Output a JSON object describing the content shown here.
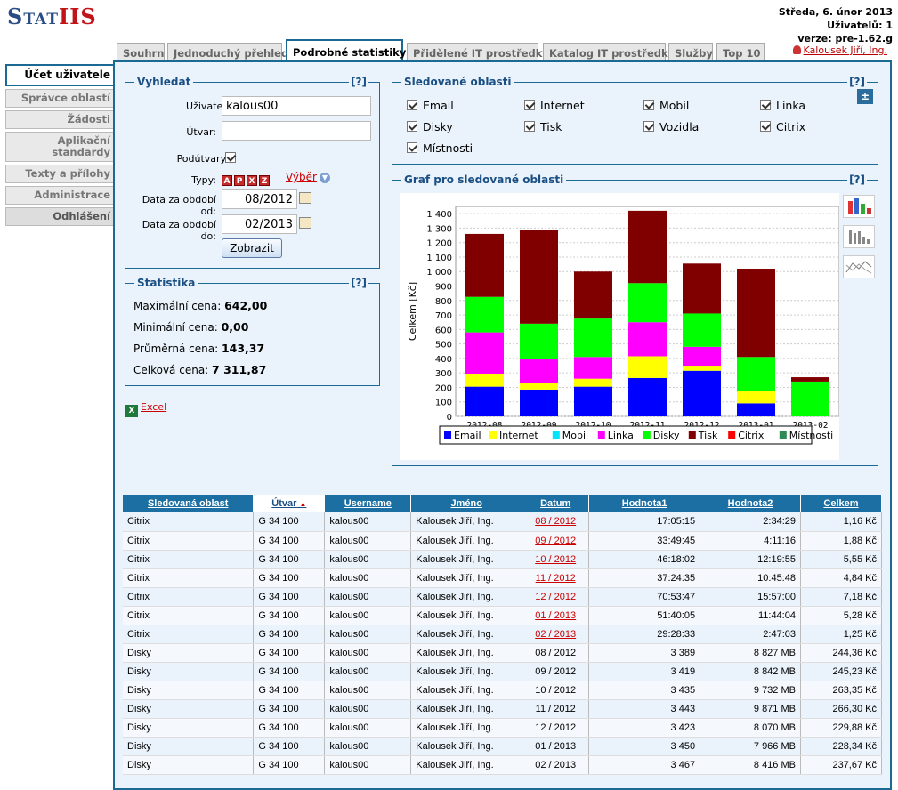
{
  "logo": {
    "part1": "Stat",
    "part2": "IIS"
  },
  "header": {
    "date": "Středa, 6. únor 2013",
    "users": "Uživatelů: 1",
    "version": "verze: pre-1.62.g",
    "user": "Kalousek Jiří, Ing."
  },
  "tabs": [
    "Souhrn",
    "Jednoduchý přehled",
    "Podrobné statistiky",
    "Přidělené IT prostředky",
    "Katalog IT prostředků",
    "Služby",
    "Top 10"
  ],
  "sidebar": [
    "Účet uživatele",
    "Správce oblastí",
    "Žádosti",
    "Aplikační standardy",
    "Texty a přílohy",
    "Administrace",
    "Odhlášení"
  ],
  "search": {
    "legend": "Vyhledat",
    "help": "[?]",
    "user_label": "Uživatel:",
    "user_value": "kalous00",
    "unit_label": "Útvar:",
    "unit_value": "",
    "subunits_label": "Podútvary:",
    "types_label": "Typy:",
    "types_icons": [
      "A",
      "P",
      "X",
      "Z"
    ],
    "select_link": "Výběr",
    "from_label": "Data za období od:",
    "from_value": "08/2012",
    "to_label": "Data za období do:",
    "to_value": "02/2013",
    "show_button": "Zobrazit"
  },
  "statistics": {
    "legend": "Statistika",
    "help": "[?]",
    "max_label": "Maximální cena:",
    "max_value": "642,00",
    "min_label": "Minimální cena:",
    "min_value": "0,00",
    "avg_label": "Průměrná cena:",
    "avg_value": "143,37",
    "total_label": "Celková cena:",
    "total_value": "7 311,87"
  },
  "excel": "Excel",
  "areas": {
    "legend": "Sledované oblasti",
    "help": "[?]",
    "items": [
      "Email",
      "Internet",
      "Mobil",
      "Linka",
      "Disky",
      "Tisk",
      "Vozidla",
      "Citrix",
      "Místnosti"
    ]
  },
  "chart_panel": {
    "legend": "Graf pro sledované oblasti",
    "help": "[?]"
  },
  "chart_data": {
    "type": "bar",
    "stacked": true,
    "categories": [
      "2012-08",
      "2012-09",
      "2012-10",
      "2012-11",
      "2012-12",
      "2013-01",
      "2013-02"
    ],
    "ylabel": "Celkem [Kč]",
    "ylim": [
      0,
      1450
    ],
    "yticks": [
      "0",
      "100",
      "200",
      "300",
      "400",
      "500",
      "600",
      "700",
      "800",
      "900",
      "1 000",
      "1 100",
      "1 200",
      "1 300",
      "1 400"
    ],
    "grid": true,
    "legend_position": "bottom",
    "series": [
      {
        "name": "Email",
        "color": "#0000ff",
        "values": [
          205,
          185,
          205,
          265,
          315,
          90,
          0
        ]
      },
      {
        "name": "Internet",
        "color": "#ffff00",
        "values": [
          90,
          45,
          55,
          150,
          35,
          85,
          0
        ]
      },
      {
        "name": "Mobil",
        "color": "#00e5ff",
        "values": [
          0,
          0,
          0,
          0,
          0,
          0,
          0
        ]
      },
      {
        "name": "Linka",
        "color": "#ff00ff",
        "values": [
          285,
          165,
          150,
          235,
          130,
          0,
          0
        ]
      },
      {
        "name": "Disky",
        "color": "#00ff00",
        "values": [
          245,
          245,
          265,
          270,
          230,
          235,
          240
        ]
      },
      {
        "name": "Tisk",
        "color": "#800000",
        "values": [
          435,
          645,
          325,
          500,
          345,
          610,
          30
        ]
      },
      {
        "name": "Citrix",
        "color": "#ff0000",
        "values": [
          0,
          0,
          0,
          0,
          0,
          0,
          0
        ]
      },
      {
        "name": "Místnosti",
        "color": "#2e8b57",
        "values": [
          0,
          0,
          0,
          0,
          0,
          0,
          0
        ]
      }
    ]
  },
  "table": {
    "headers": [
      "Sledovaná oblast",
      "Útvar",
      "Username",
      "Jméno",
      "Datum",
      "Hodnota1",
      "Hodnota2",
      "Celkem"
    ],
    "rows": [
      [
        "Citrix",
        "G 34 100",
        "kalous00",
        "Kalousek Jiří, Ing.",
        "08 / 2012",
        "17:05:15",
        "2:34:29",
        "1,16 Kč"
      ],
      [
        "Citrix",
        "G 34 100",
        "kalous00",
        "Kalousek Jiří, Ing.",
        "09 / 2012",
        "33:49:45",
        "4:11:16",
        "1,88 Kč"
      ],
      [
        "Citrix",
        "G 34 100",
        "kalous00",
        "Kalousek Jiří, Ing.",
        "10 / 2012",
        "46:18:02",
        "12:19:55",
        "5,55 Kč"
      ],
      [
        "Citrix",
        "G 34 100",
        "kalous00",
        "Kalousek Jiří, Ing.",
        "11 / 2012",
        "37:24:35",
        "10:45:48",
        "4,84 Kč"
      ],
      [
        "Citrix",
        "G 34 100",
        "kalous00",
        "Kalousek Jiří, Ing.",
        "12 / 2012",
        "70:53:47",
        "15:57:00",
        "7,18 Kč"
      ],
      [
        "Citrix",
        "G 34 100",
        "kalous00",
        "Kalousek Jiří, Ing.",
        "01 / 2013",
        "51:40:05",
        "11:44:04",
        "5,28 Kč"
      ],
      [
        "Citrix",
        "G 34 100",
        "kalous00",
        "Kalousek Jiří, Ing.",
        "02 / 2013",
        "29:28:33",
        "2:47:03",
        "1,25 Kč"
      ],
      [
        "Disky",
        "G 34 100",
        "kalous00",
        "Kalousek Jiří, Ing.",
        "08 / 2012",
        "3 389",
        "8 827 MB",
        "244,36 Kč"
      ],
      [
        "Disky",
        "G 34 100",
        "kalous00",
        "Kalousek Jiří, Ing.",
        "09 / 2012",
        "3 419",
        "8 842 MB",
        "245,23 Kč"
      ],
      [
        "Disky",
        "G 34 100",
        "kalous00",
        "Kalousek Jiří, Ing.",
        "10 / 2012",
        "3 435",
        "9 732 MB",
        "263,35 Kč"
      ],
      [
        "Disky",
        "G 34 100",
        "kalous00",
        "Kalousek Jiří, Ing.",
        "11 / 2012",
        "3 443",
        "9 871 MB",
        "266,30 Kč"
      ],
      [
        "Disky",
        "G 34 100",
        "kalous00",
        "Kalousek Jiří, Ing.",
        "12 / 2012",
        "3 423",
        "8 070 MB",
        "229,88 Kč"
      ],
      [
        "Disky",
        "G 34 100",
        "kalous00",
        "Kalousek Jiří, Ing.",
        "01 / 2013",
        "3 450",
        "7 966 MB",
        "228,34 Kč"
      ],
      [
        "Disky",
        "G 34 100",
        "kalous00",
        "Kalousek Jiří, Ing.",
        "02 / 2013",
        "3 467",
        "8 416 MB",
        "237,67 Kč"
      ]
    ]
  }
}
